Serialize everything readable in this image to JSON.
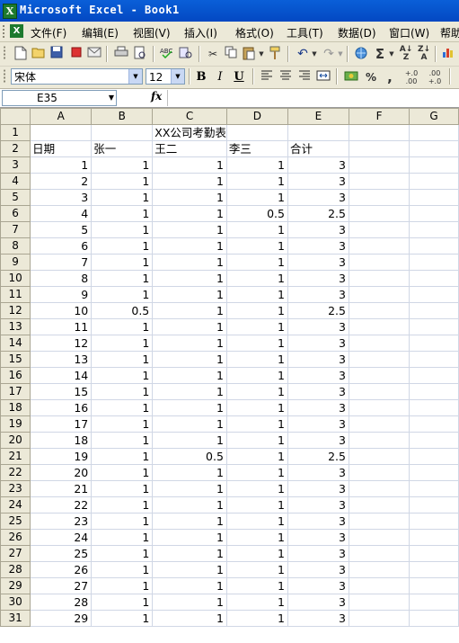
{
  "window": {
    "title": "Microsoft Excel - Book1",
    "app_icon_letter": "X"
  },
  "menu": [
    "文件(F)",
    "编辑(E)",
    "视图(V)",
    "插入(I)",
    "格式(O)",
    "工具(T)",
    "数据(D)",
    "窗口(W)",
    "帮助"
  ],
  "toolbar": {
    "font_name": "宋体",
    "font_size": "12",
    "bold": "B",
    "italic": "I",
    "underline": "U",
    "percent": "%",
    "comma": ",",
    "inc_decimal": "+.0\n.00",
    "dec_decimal": ".00\n+.0",
    "sum": "Σ"
  },
  "formula_bar": {
    "name_box": "E35",
    "fx": "fx",
    "content": ""
  },
  "columns": [
    "A",
    "B",
    "C",
    "D",
    "E",
    "F",
    "G"
  ],
  "sheet": {
    "title": "XX公司考勤表",
    "headers": [
      "日期",
      "张一",
      "王二",
      "李三",
      "合计"
    ],
    "rows": [
      [
        "1",
        "1",
        "1",
        "1",
        "3"
      ],
      [
        "2",
        "1",
        "1",
        "1",
        "3"
      ],
      [
        "3",
        "1",
        "1",
        "1",
        "3"
      ],
      [
        "4",
        "1",
        "1",
        "0.5",
        "2.5"
      ],
      [
        "5",
        "1",
        "1",
        "1",
        "3"
      ],
      [
        "6",
        "1",
        "1",
        "1",
        "3"
      ],
      [
        "7",
        "1",
        "1",
        "1",
        "3"
      ],
      [
        "8",
        "1",
        "1",
        "1",
        "3"
      ],
      [
        "9",
        "1",
        "1",
        "1",
        "3"
      ],
      [
        "10",
        "0.5",
        "1",
        "1",
        "2.5"
      ],
      [
        "11",
        "1",
        "1",
        "1",
        "3"
      ],
      [
        "12",
        "1",
        "1",
        "1",
        "3"
      ],
      [
        "13",
        "1",
        "1",
        "1",
        "3"
      ],
      [
        "14",
        "1",
        "1",
        "1",
        "3"
      ],
      [
        "15",
        "1",
        "1",
        "1",
        "3"
      ],
      [
        "16",
        "1",
        "1",
        "1",
        "3"
      ],
      [
        "17",
        "1",
        "1",
        "1",
        "3"
      ],
      [
        "18",
        "1",
        "1",
        "1",
        "3"
      ],
      [
        "19",
        "1",
        "0.5",
        "1",
        "2.5"
      ],
      [
        "20",
        "1",
        "1",
        "1",
        "3"
      ],
      [
        "21",
        "1",
        "1",
        "1",
        "3"
      ],
      [
        "22",
        "1",
        "1",
        "1",
        "3"
      ],
      [
        "23",
        "1",
        "1",
        "1",
        "3"
      ],
      [
        "24",
        "1",
        "1",
        "1",
        "3"
      ],
      [
        "25",
        "1",
        "1",
        "1",
        "3"
      ],
      [
        "26",
        "1",
        "1",
        "1",
        "3"
      ],
      [
        "27",
        "1",
        "1",
        "1",
        "3"
      ],
      [
        "28",
        "1",
        "1",
        "1",
        "3"
      ],
      [
        "29",
        "1",
        "1",
        "1",
        "3"
      ]
    ]
  }
}
